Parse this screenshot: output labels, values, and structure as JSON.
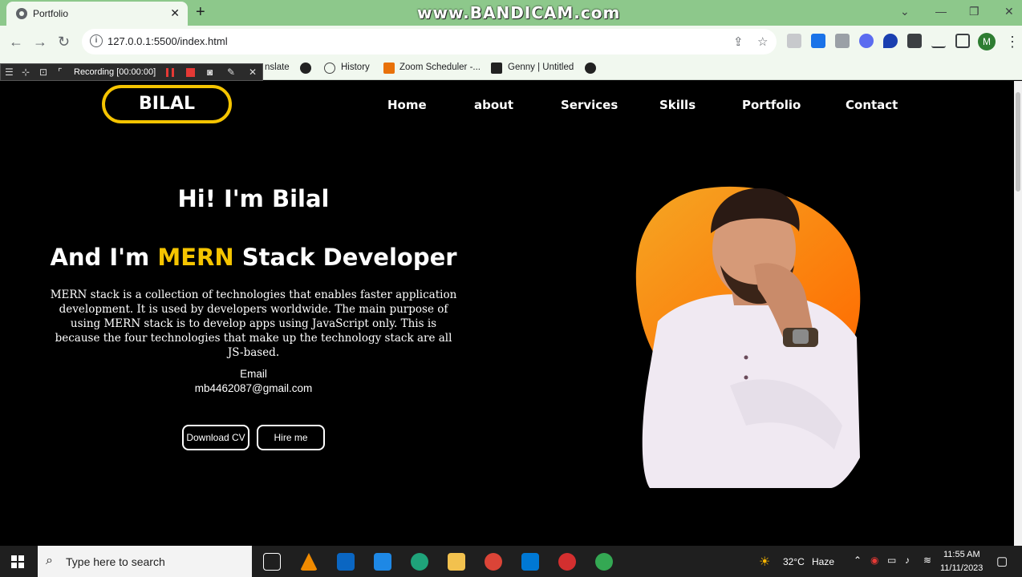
{
  "browser": {
    "tab_title": "Portfolio",
    "tab_close": "✕",
    "new_tab": "+",
    "overlay_watermark": "www.BANDICAM.com",
    "url": "127.0.0.1:5500/index.html",
    "profile_initial": "M"
  },
  "bookmarks": {
    "items": [
      {
        "label": "nslate"
      },
      {
        "label": "History"
      },
      {
        "label": "Zoom Scheduler -..."
      },
      {
        "label": "Genny | Untitled"
      }
    ]
  },
  "recorder": {
    "status": "Recording [00:00:00]"
  },
  "site": {
    "logo": "BILAL",
    "nav": [
      "Home",
      "about",
      "Services",
      "Skills",
      "Portfolio",
      "Contact"
    ],
    "greeting": "Hi! I'm Bilal",
    "role_prefix": "And I'm ",
    "role_highlight": "MERN",
    "role_suffix": " Stack Developer",
    "description": "MERN stack is a collection of technologies that enables faster application development. It is used by developers worldwide. The main purpose of using MERN stack is to develop apps using JavaScript only. This is because the four technologies that make up the technology stack are all JS-based.",
    "email_label": "Email",
    "email_value": "mb4462087@gmail.com",
    "btn_download": "Download CV",
    "btn_hire": "Hire me",
    "accent_color": "#f5c400"
  },
  "taskbar": {
    "search_placeholder": "Type here to search",
    "weather_temp": "32°C",
    "weather_desc": "Haze",
    "time": "11:55 AM",
    "date": "11/11/2023"
  }
}
